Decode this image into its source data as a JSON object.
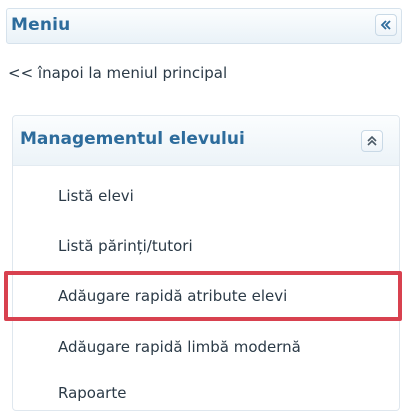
{
  "menu": {
    "title": "Meniu",
    "collapse_icon": "double-chevron-left-icon"
  },
  "back_link": {
    "label": "<< înapoi la meniul principal"
  },
  "section": {
    "title": "Managementul elevului",
    "toggle_icon": "double-chevron-up-icon",
    "items": [
      {
        "label": "Listă elevi"
      },
      {
        "label": "Listă părinți/tutori"
      },
      {
        "label": "Adăugare rapidă atribute elevi",
        "highlighted": true
      },
      {
        "label": "Adăugare rapidă limbă modernă"
      },
      {
        "label": "Rapoarte"
      }
    ]
  },
  "colors": {
    "accent": "#2d6c9c",
    "text": "#2b3a47",
    "highlight": "#d8414f"
  }
}
